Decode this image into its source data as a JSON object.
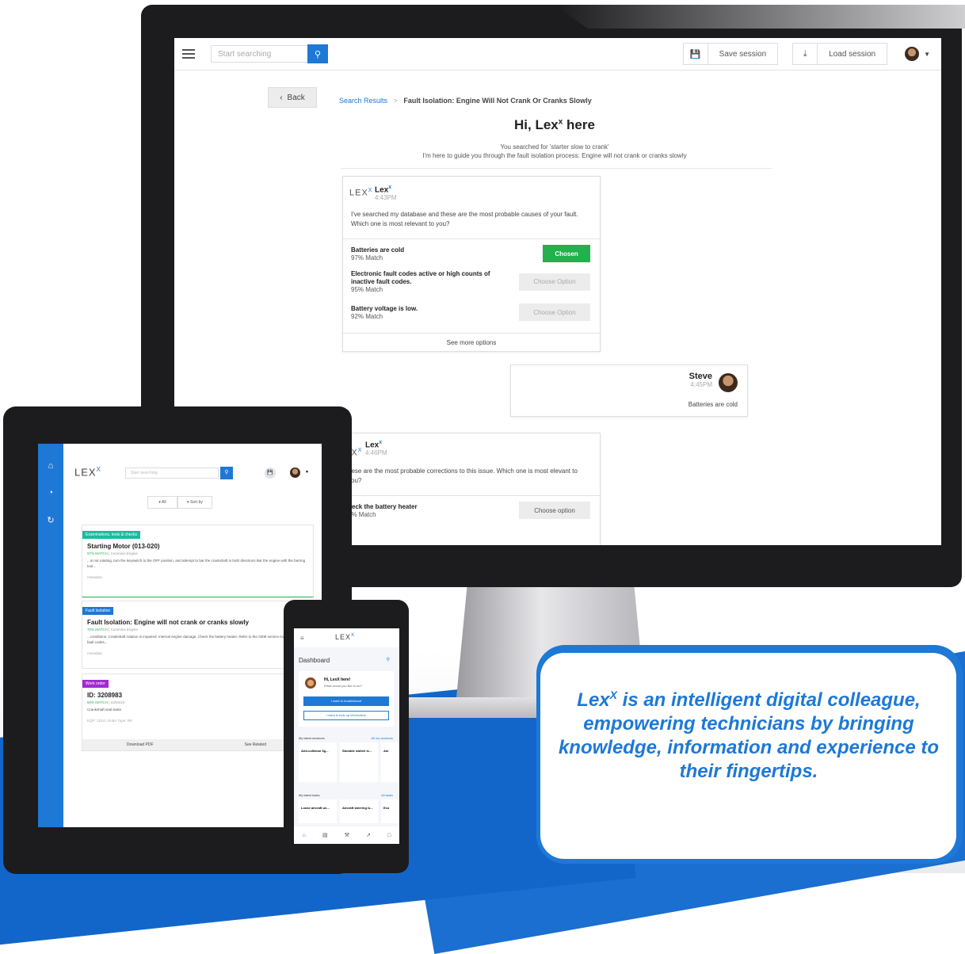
{
  "desktop": {
    "search_placeholder": "Start searching",
    "save_session": "Save session",
    "load_session": "Load session",
    "back": "Back",
    "breadcrumb_link": "Search Results",
    "breadcrumb_current": "Fault Isolation: Engine Will Not Crank Or Cranks Slowly",
    "greeting": "Hi, Lex",
    "greeting_sup": "x",
    "greeting_tail": " here",
    "subtitle_1": "You searched for 'starter slow to crank'",
    "subtitle_2": "I'm here to guide you through the fault isolation process: Engine will not crank or cranks slowly",
    "bot1": {
      "logo": "LEX",
      "logo_sup": "X",
      "name": "Lex",
      "name_sup": "x",
      "time": "4:43PM",
      "message": "I've searched my database and these are the most probable causes of your fault. Which one is most relevant to you?",
      "options": [
        {
          "title": "Batteries are cold",
          "match": "97% Match",
          "button": "Chosen"
        },
        {
          "title": "Electronic fault codes active or high counts of inactive fault codes.",
          "match": "95% Match",
          "button": "Choose Option"
        },
        {
          "title": "Battery voltage is low.",
          "match": "92% Match",
          "button": "Choose Option"
        }
      ],
      "see_more": "See more options"
    },
    "user": {
      "name": "Steve",
      "time": "4:45PM",
      "message": "Batteries are cold"
    },
    "bot2": {
      "logo": "EX",
      "logo_sup": "X",
      "name": "Lex",
      "name_sup": "x",
      "time": "4:46PM",
      "message": "hese are the most probable corrections to this issue. Which one is most elevant to you?",
      "option_title": "heck the battery heater",
      "option_match": "7% Match",
      "option_button": "Choose option"
    }
  },
  "tablet": {
    "logo": "LEX",
    "logo_sup": "X",
    "search_placeholder": "Start searching",
    "filter_all": "All",
    "sort_by": "Sort by",
    "results": [
      {
        "tag": "Examinations, tests & checks",
        "tag_color": "#1abc9c",
        "title": "Starting Motor (013-020)",
        "match": "97% MATCH",
        "source": "Cummins Engine",
        "text": "...is not rotating, turn the keyswitch to the OFF position, and attempt to bar the crankshaft in both directions Bar the engine with the barring tool...",
        "meta": "metadata"
      },
      {
        "tag": "Fault Isolation",
        "tag_color": "#1e78d6",
        "title": "Fault Isolation: Engine will not crank or cranks slowly",
        "match": "70% MATCH",
        "source": "Cummins Engine",
        "text": "...conditions. Crankshaft rotation is impaired. Internal engine damage. Check the battery heater. Refer to the OEM service manual Read the fault codes...",
        "meta": "metadata"
      },
      {
        "tag": "Work order",
        "tag_color": "#a12bd0",
        "title": "ID: 3208983",
        "match": "50% MATCH",
        "source": "23/04/10",
        "text": "Crankshaft seal leaks",
        "meta": "EQP: 1224 | Order Type: RE"
      }
    ],
    "download_pdf": "Download PDF",
    "see_related": "See Related"
  },
  "phone": {
    "logo": "LEX",
    "logo_sup": "X",
    "dashboard": "Dashboard",
    "greeting": "Hi, LexX here!",
    "question": "What would you like to do?",
    "btn_primary": "I want to troubleshoot",
    "btn_secondary": "I want to look up information",
    "latest_sessions": "My latest sessions",
    "all_sessions": "All my sessions",
    "sessions": [
      "Anti-collision lig...",
      "Stumble switch is...",
      "Am"
    ],
    "latest_tasks": "My latest tasks",
    "all_tasks": "All tasks",
    "tasks": [
      "Loose aircraft un...",
      "Aircraft steering is...",
      "Eco"
    ]
  },
  "callout": {
    "lead": "Lex",
    "lead_sup": "X",
    "text": " is an intelligent digital colleague, empowering technicians by bringing knowledge, information and experience to their fingertips."
  },
  "colors": {
    "accent": "#1e78d6",
    "chosen": "#22b14c"
  }
}
